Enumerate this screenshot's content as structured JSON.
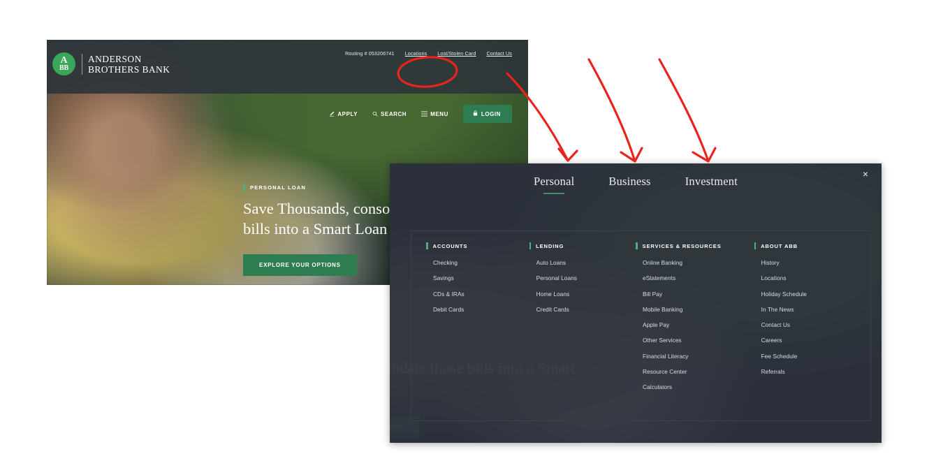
{
  "site": {
    "brand": {
      "mark_line1": "A",
      "mark_line2": "BB",
      "name_line1": "ANDERSON",
      "name_line2": "BROTHERS BANK"
    },
    "utility_links": [
      {
        "label": "Routing # 053206741",
        "underlined": false
      },
      {
        "label": "Locations",
        "underlined": true
      },
      {
        "label": "Lost/Stolen Card",
        "underlined": true
      },
      {
        "label": "Contact Us",
        "underlined": true
      }
    ],
    "actions": [
      {
        "label": "APPLY",
        "icon": "pencil-icon"
      },
      {
        "label": "SEARCH",
        "icon": "search-icon"
      },
      {
        "label": "MENU",
        "icon": "hamburger-icon"
      }
    ],
    "login": {
      "label": "LOGIN",
      "icon": "lock-icon"
    },
    "hero": {
      "eyebrow": "PERSONAL LOAN",
      "heading": "Save Thousands, consolidate those bills into a Smart Loan",
      "cta": "EXPLORE YOUR OPTIONS"
    }
  },
  "menu_panel": {
    "close_label": "×",
    "tabs": [
      {
        "label": "Personal",
        "active": true
      },
      {
        "label": "Business",
        "active": false
      },
      {
        "label": "Investment",
        "active": false
      }
    ],
    "columns": [
      {
        "heading": "ACCOUNTS",
        "items": [
          "Checking",
          "Savings",
          "CDs & IRAs",
          "Debit Cards"
        ]
      },
      {
        "heading": "LENDING",
        "items": [
          "Auto Loans",
          "Personal Loans",
          "Home Loans",
          "Credit Cards"
        ]
      },
      {
        "heading": "SERVICES & RESOURCES",
        "items": [
          "Online Banking",
          "eStatements",
          "Bill Pay",
          "Mobile Banking",
          "Apple Pay",
          "Other Services",
          "Financial Literacy",
          "Resource Center",
          "Calculators"
        ]
      },
      {
        "heading": "ABOUT ABB",
        "items": [
          "History",
          "Locations",
          "Holiday Schedule",
          "In The News",
          "Contact Us",
          "Careers",
          "Fee Schedule",
          "Referrals"
        ]
      }
    ]
  },
  "annotations": {
    "color": "#e8241c",
    "ellipse_target": "MENU",
    "arrow_targets": [
      "Personal",
      "Business",
      "Investment"
    ]
  },
  "colors": {
    "brand_green": "#3aa65a",
    "button_green": "#2e7d51",
    "accent_green": "#4caf7d",
    "panel_bg": "#2b303b",
    "topbar_bg": "#2e343a",
    "annotation_red": "#e8241c"
  }
}
